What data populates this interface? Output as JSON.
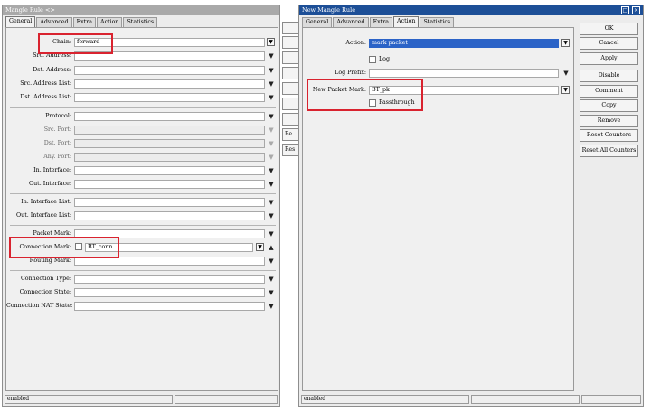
{
  "left": {
    "title": "Mangle Rule <>",
    "tabs": [
      "General",
      "Advanced",
      "Extra",
      "Action",
      "Statistics"
    ],
    "chain_label": "Chain:",
    "chain_value": "forward",
    "src_address_label": "Src. Address:",
    "dst_address_label": "Dst. Address:",
    "src_address_list_label": "Src. Address List:",
    "dst_address_list_label": "Dst. Address List:",
    "protocol_label": "Protocol:",
    "src_port_label": "Src. Port:",
    "dst_port_label": "Dst. Port:",
    "any_port_label": "Any. Port:",
    "in_interface_label": "In. Interface:",
    "out_interface_label": "Out. Interface:",
    "in_interface_list_label": "In. Interface List:",
    "out_interface_list_label": "Out. Interface List:",
    "packet_mark_label": "Packet Mark:",
    "connection_mark_label": "Connection Mark:",
    "connection_mark_value": "BT_conn",
    "routing_mark_label": "Routing Mark:",
    "connection_type_label": "Connection Type:",
    "connection_state_label": "Connection State:",
    "connection_nat_state_label": "Connection NAT State:",
    "status_text": "enabled"
  },
  "middle_stubs": [
    "Re",
    "Res"
  ],
  "right": {
    "title": "New Mangle Rule",
    "tabs": [
      "General",
      "Advanced",
      "Extra",
      "Action",
      "Statistics"
    ],
    "action_label": "Action:",
    "action_value": "mark packet",
    "log_label": "Log",
    "log_prefix_label": "Log Prefix:",
    "new_packet_mark_label": "New Packet Mark:",
    "new_packet_mark_value": "BT_pk",
    "passthrough_label": "Passthrough",
    "buttons": [
      "OK",
      "Cancel",
      "Apply",
      "Disable",
      "Comment",
      "Copy",
      "Remove",
      "Reset Counters",
      "Reset All Counters"
    ],
    "status_text": "enabled"
  }
}
